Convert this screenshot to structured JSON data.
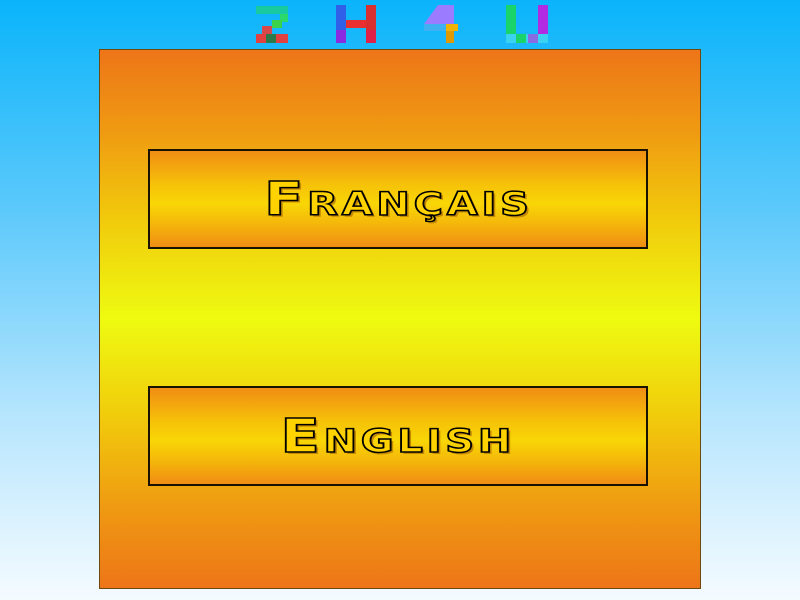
{
  "logo": {
    "chars": [
      "2",
      "H",
      "4",
      "U"
    ],
    "colors": [
      "#1fcf6a",
      "#8a2be2",
      "#f0b400",
      "#19d36b"
    ]
  },
  "menu": {
    "french_label": "Français",
    "english_label": "English"
  },
  "colors": {
    "sky_top": "#0ab4fb",
    "panel_center": "#eefb10",
    "panel_edge": "#ee7518",
    "label_fill": "#ffd200"
  }
}
